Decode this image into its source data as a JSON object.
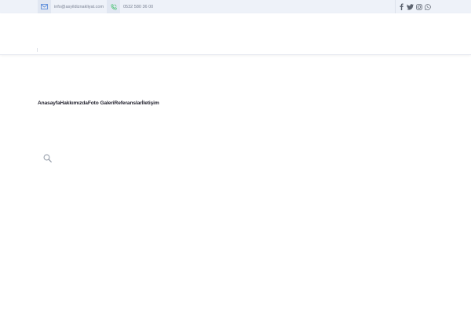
{
  "topbar": {
    "email": "info@asyildiznakliyat.com",
    "phone": "0532 580 36 00"
  },
  "social": {
    "icons": [
      "facebook-icon",
      "twitter-icon",
      "instagram-icon",
      "whatsapp-icon"
    ]
  },
  "nav": {
    "items": [
      {
        "label": "Anasayfa"
      },
      {
        "label": "Hakkımızda"
      },
      {
        "label": "Foto Galeri"
      },
      {
        "label": "Referanslar"
      },
      {
        "label": "İletişim"
      }
    ]
  },
  "search": {
    "icon": "search-icon"
  },
  "colors": {
    "topbar_bg": "#eef2f9",
    "email_icon": "#4f84d8",
    "phone_icon": "#3dbf69",
    "text_muted": "#7b8394",
    "nav_text": "#1f1f2b"
  }
}
